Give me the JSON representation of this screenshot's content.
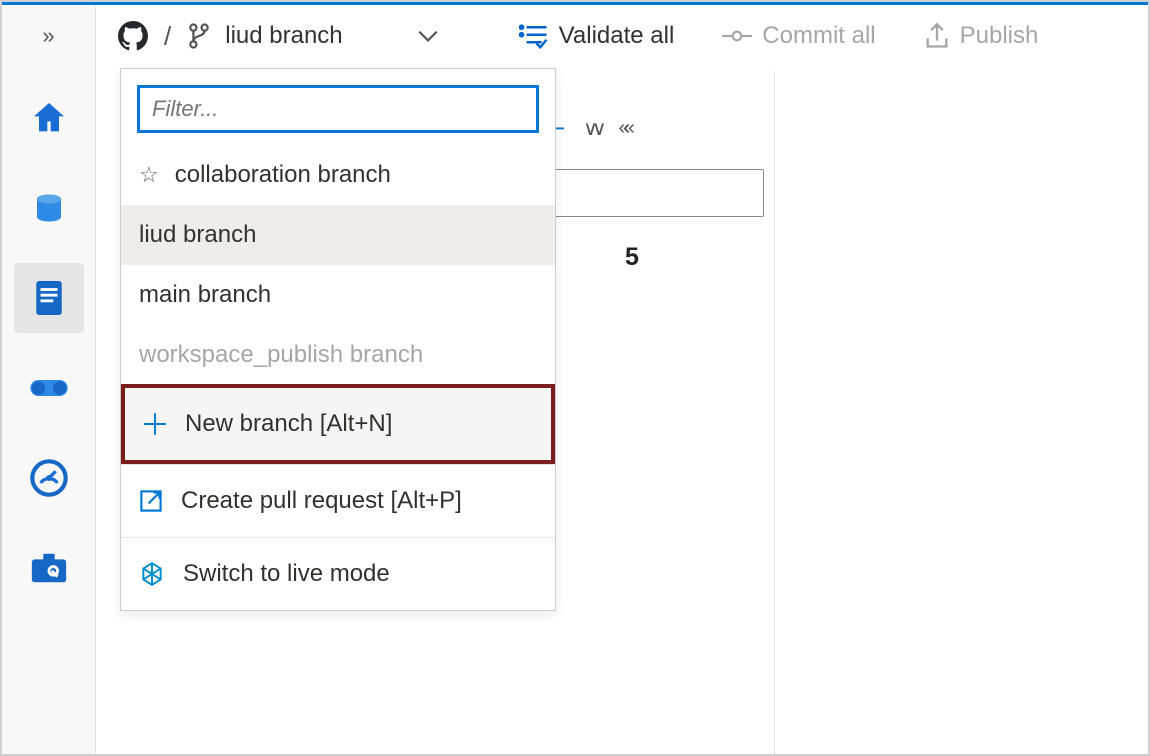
{
  "toolbar": {
    "current_branch": "liud branch",
    "validate_label": "Validate all",
    "commit_label": "Commit all",
    "publish_label": "Publish"
  },
  "dropdown": {
    "filter_placeholder": "Filter...",
    "collab_branch": "collaboration branch",
    "branches": {
      "selected": "liud branch",
      "main": "main branch",
      "publish": "workspace_publish branch"
    },
    "actions": {
      "new_branch": "New branch [Alt+N]",
      "pull_request": "Create pull request [Alt+P]",
      "live_mode": "Switch to live mode"
    }
  },
  "content": {
    "count": "5"
  },
  "icons": {
    "home": "home-icon",
    "data": "data-icon",
    "develop": "develop-icon",
    "integrate": "integrate-icon",
    "monitor": "monitor-icon",
    "manage": "manage-icon"
  }
}
